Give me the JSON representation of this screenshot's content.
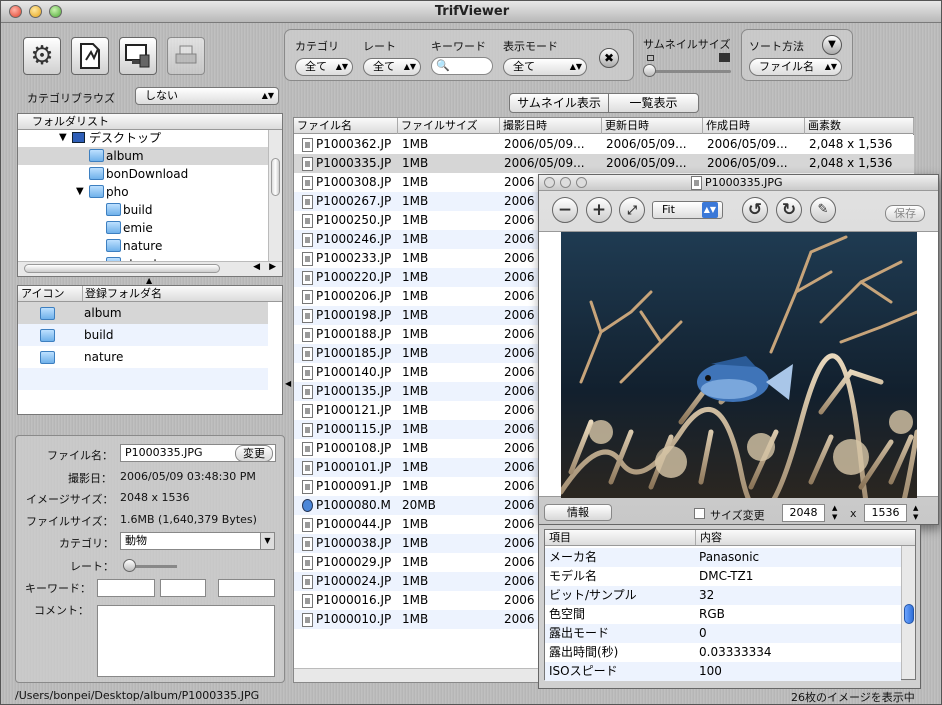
{
  "window": {
    "title": "TrifViewer"
  },
  "toolbar": {
    "icons": [
      "gear-icon",
      "document-icon",
      "monitor-icon",
      "printer-icon"
    ]
  },
  "filters": {
    "category_label": "カテゴリ",
    "category_value": "全て",
    "rate_label": "レート",
    "rate_value": "全て",
    "keyword_label": "キーワード",
    "display_mode_label": "表示モード",
    "display_mode_value": "全て",
    "thumb_size_label": "サムネイルサイズ",
    "sort_label": "ソート方法",
    "sort_value": "ファイル名"
  },
  "browse": {
    "label": "カテゴリブラウズ",
    "value": "しない"
  },
  "folder_list": {
    "header": "フォルダリスト",
    "items": [
      {
        "label": "デスクトップ",
        "level": 0,
        "expanded": true
      },
      {
        "label": "album",
        "level": 1
      },
      {
        "label": "bonDownload",
        "level": 1
      },
      {
        "label": "pho",
        "level": 1,
        "expanded": true
      },
      {
        "label": "build",
        "level": 2
      },
      {
        "label": "emie",
        "level": 2
      },
      {
        "label": "nature",
        "level": 2
      },
      {
        "label": "street",
        "level": 2
      }
    ]
  },
  "registered": {
    "col_icon": "アイコン",
    "col_name": "登録フォルダ名",
    "items": [
      "album",
      "build",
      "nature"
    ]
  },
  "info": {
    "filename_label": "ファイル名：",
    "filename_value": "P1000335.JPG",
    "change_button": "変更",
    "date_label": "撮影日：",
    "date_value": "2006/05/09 03:48:30 PM",
    "imgsize_label": "イメージサイズ：",
    "imgsize_value": "2048 x 1536",
    "filesize_label": "ファイルサイズ：",
    "filesize_value": "1.6MB (1,640,379 Bytes)",
    "category_label": "カテゴリ：",
    "category_value": "動物",
    "rate_label": "レート：",
    "keyword_label": "キーワード：",
    "comment_label": "コメント："
  },
  "view_tabs": {
    "thumbnail": "サムネイル表示",
    "list": "一覧表示"
  },
  "table": {
    "columns": [
      "ファイル名",
      "ファイルサイズ",
      "撮影日時",
      "更新日時",
      "作成日時",
      "画素数"
    ],
    "rows": [
      [
        "P1000362.JP",
        "1MB",
        "2006/05/09...",
        "2006/05/09...",
        "2006/05/09...",
        "2,048 x 1,536"
      ],
      [
        "P1000335.JP",
        "1MB",
        "2006/05/09...",
        "2006/05/09...",
        "2006/05/09...",
        "2,048 x 1,536"
      ],
      [
        "P1000308.JP",
        "1MB",
        "2006"
      ],
      [
        "P1000267.JP",
        "1MB",
        "2006"
      ],
      [
        "P1000250.JP",
        "1MB",
        "2006"
      ],
      [
        "P1000246.JP",
        "1MB",
        "2006"
      ],
      [
        "P1000233.JP",
        "1MB",
        "2006"
      ],
      [
        "P1000220.JP",
        "1MB",
        "2006"
      ],
      [
        "P1000206.JP",
        "1MB",
        "2006"
      ],
      [
        "P1000198.JP",
        "1MB",
        "2006"
      ],
      [
        "P1000188.JP",
        "1MB",
        "2006"
      ],
      [
        "P1000185.JP",
        "1MB",
        "2006"
      ],
      [
        "P1000140.JP",
        "1MB",
        "2006"
      ],
      [
        "P1000135.JP",
        "1MB",
        "2006"
      ],
      [
        "P1000121.JP",
        "1MB",
        "2006"
      ],
      [
        "P1000115.JP",
        "1MB",
        "2006"
      ],
      [
        "P1000108.JP",
        "1MB",
        "2006"
      ],
      [
        "P1000101.JP",
        "1MB",
        "2006"
      ],
      [
        "P1000091.JP",
        "1MB",
        "2006"
      ],
      [
        "P1000080.M",
        "20MB",
        "2006"
      ],
      [
        "P1000044.JP",
        "1MB",
        "2006"
      ],
      [
        "P1000038.JP",
        "1MB",
        "2006"
      ],
      [
        "P1000029.JP",
        "1MB",
        "2006"
      ],
      [
        "P1000024.JP",
        "1MB",
        "2006"
      ],
      [
        "P1000016.JP",
        "1MB",
        "2006"
      ],
      [
        "P1000010.JP",
        "1MB",
        "2006"
      ]
    ]
  },
  "viewer": {
    "title": "P1000335.JPG",
    "zoom_value": "Fit",
    "save_button": "保存",
    "info_button": "情報",
    "resize_label": "サイズ変更",
    "width": "2048",
    "x": "x",
    "height": "1536"
  },
  "exif": {
    "col_item": "項目",
    "col_value": "内容",
    "rows": [
      [
        "メーカ名",
        "Panasonic"
      ],
      [
        "モデル名",
        "DMC-TZ1"
      ],
      [
        "ビット/サンプル",
        "32"
      ],
      [
        "色空間",
        "RGB"
      ],
      [
        "露出モード",
        "0"
      ],
      [
        "露出時間(秒)",
        "0.03333334"
      ],
      [
        "ISOスピード",
        "100"
      ]
    ]
  },
  "status": {
    "path": "/Users/bonpei/Desktop/album/P1000335.JPG",
    "count": "26枚のイメージを表示中"
  }
}
